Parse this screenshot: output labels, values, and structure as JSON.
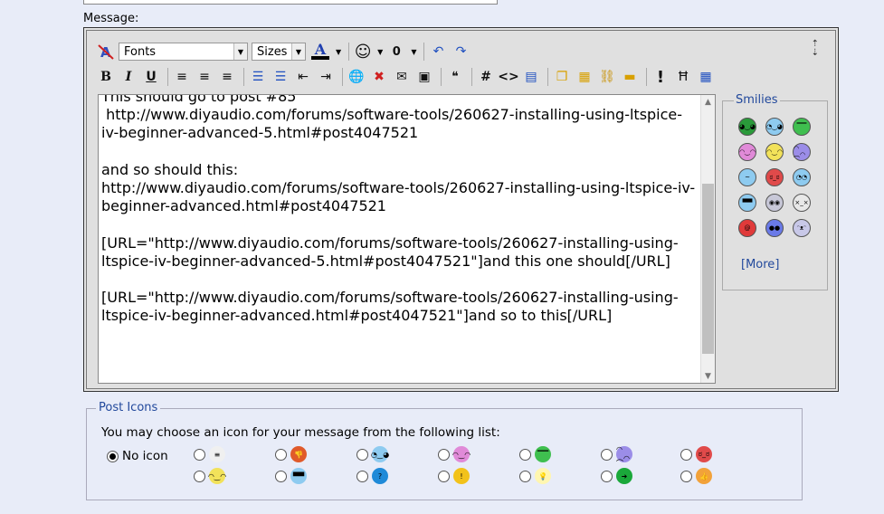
{
  "message_label": "Message:",
  "toolbar": {
    "fonts_label": "Fonts",
    "sizes_label": "Sizes",
    "font_color_glyph": "A",
    "bold": "B",
    "italic": "I",
    "underline": "U",
    "code_hash": "#",
    "html_tag": "<>",
    "alert_glyph": "!"
  },
  "editor": {
    "text": "This should go to post #85\n http://www.diyaudio.com/forums/software-tools/260627-installing-using-ltspice-iv-beginner-advanced-5.html#post4047521\n\nand so should this:\nhttp://www.diyaudio.com/forums/software-tools/260627-installing-using-ltspice-iv-beginner-advanced.html#post4047521\n\n[URL=\"http://www.diyaudio.com/forums/software-tools/260627-installing-using-ltspice-iv-beginner-advanced-5.html#post4047521\"]and this one should[/URL]\n\n[URL=\"http://www.diyaudio.com/forums/software-tools/260627-installing-using-ltspice-iv-beginner-advanced.html#post4047521\"]and so to this[/URL]"
  },
  "smilies": {
    "title": "Smilies",
    "more_open": "[",
    "more_link": "More",
    "more_close": "]",
    "items": [
      {
        "icon": "green-face-icon",
        "color": "#2a9a3a",
        "glyph": "◕‿◕"
      },
      {
        "icon": "wink-face-icon",
        "color": "#8ecbf0",
        "glyph": "◔‿◕"
      },
      {
        "icon": "grin-face-icon",
        "color": "#3fbf4f",
        "glyph": "▔▔"
      },
      {
        "icon": "tongue-face-icon",
        "color": "#e08ad8",
        "glyph": "◠‿◠"
      },
      {
        "icon": "smile-face-icon",
        "color": "#f2e25a",
        "glyph": "◠‿◠"
      },
      {
        "icon": "frown-face-icon",
        "color": "#9b8de8",
        "glyph": "◠︵◠"
      },
      {
        "icon": "confused-face-icon",
        "color": "#8ecbf0",
        "glyph": "~"
      },
      {
        "icon": "mad-face-icon",
        "color": "#e04a4a",
        "glyph": "ಠ_ಠ"
      },
      {
        "icon": "rolleyes-face-icon",
        "color": "#8ecbf0",
        "glyph": "◔◔"
      },
      {
        "icon": "cool-face-icon",
        "color": "#8ecbf0",
        "glyph": "▀▀"
      },
      {
        "icon": "eek-face-icon",
        "color": "#c8c8d8",
        "glyph": "◉◉"
      },
      {
        "icon": "sick-face-icon",
        "color": "#e8e8e8",
        "glyph": "×_×"
      },
      {
        "icon": "spiral-face-icon",
        "color": "#e03a3a",
        "glyph": "@"
      },
      {
        "icon": "blue-face-icon",
        "color": "#6a7ae8",
        "glyph": "●●"
      },
      {
        "icon": "alien-face-icon",
        "color": "#c8c8e8",
        "glyph": "ᵔᴥᵔ"
      }
    ]
  },
  "post_icons": {
    "title": "Post Icons",
    "description": "You may choose an icon for your message from the following list:",
    "no_icon_label": "No icon",
    "options": [
      {
        "icon": "document-icon",
        "color": "#f0f0f0",
        "glyph": "≡"
      },
      {
        "icon": "thumbs-down-icon",
        "color": "#e05a2a",
        "glyph": "👎"
      },
      {
        "icon": "wink-face-icon",
        "color": "#8ecbf0",
        "glyph": "◔‿◕"
      },
      {
        "icon": "tongue-face-icon",
        "color": "#e08ad8",
        "glyph": "◠‿◠"
      },
      {
        "icon": "grin-face-icon",
        "color": "#3fbf4f",
        "glyph": "▔▔"
      },
      {
        "icon": "frown-face-icon",
        "color": "#9b8de8",
        "glyph": "◠︵◠"
      },
      {
        "icon": "mad-face-icon",
        "color": "#e04a4a",
        "glyph": "ಠ_ಠ"
      },
      {
        "icon": "smile-face-icon",
        "color": "#f2e25a",
        "glyph": "◠‿◠"
      },
      {
        "icon": "cool-face-icon",
        "color": "#8ecbf0",
        "glyph": "▀▀"
      },
      {
        "icon": "question-icon",
        "color": "#1f8ad8",
        "glyph": "?"
      },
      {
        "icon": "warning-icon",
        "color": "#f2c21a",
        "glyph": "!"
      },
      {
        "icon": "lightbulb-icon",
        "color": "#fff6b0",
        "glyph": "💡"
      },
      {
        "icon": "arrow-icon",
        "color": "#1aa83a",
        "glyph": "➜"
      },
      {
        "icon": "thumbs-up-icon",
        "color": "#f2a23a",
        "glyph": "👍"
      }
    ]
  }
}
